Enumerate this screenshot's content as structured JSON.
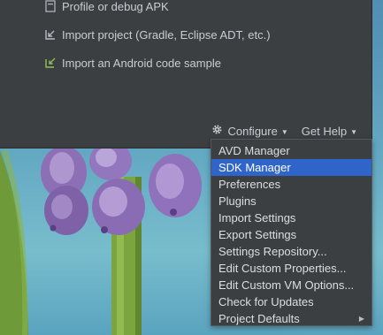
{
  "welcome": {
    "actions": [
      {
        "label": "Profile or debug APK",
        "icon": "apk-icon"
      },
      {
        "label": "Import project (Gradle, Eclipse ADT, etc.)",
        "icon": "import-project-icon"
      },
      {
        "label": "Import an Android code sample",
        "icon": "android-sample-icon"
      }
    ],
    "configure_label": "Configure",
    "get_help_label": "Get Help"
  },
  "configure_menu": {
    "items": [
      {
        "label": "AVD Manager",
        "selected": false
      },
      {
        "label": "SDK Manager",
        "selected": true
      },
      {
        "label": "Preferences",
        "selected": false
      },
      {
        "label": "Plugins",
        "selected": false
      },
      {
        "label": "Import Settings",
        "selected": false
      },
      {
        "label": "Export Settings",
        "selected": false
      },
      {
        "label": "Settings Repository...",
        "selected": false
      },
      {
        "label": "Edit Custom Properties...",
        "selected": false
      },
      {
        "label": "Edit Custom VM Options...",
        "selected": false
      },
      {
        "label": "Check for Updates",
        "selected": false
      },
      {
        "label": "Project Defaults",
        "selected": false,
        "has_submenu": true
      }
    ]
  },
  "colors": {
    "panel_bg": "#3c3f41",
    "selection": "#2f65ca",
    "text": "#dcdfe2"
  }
}
